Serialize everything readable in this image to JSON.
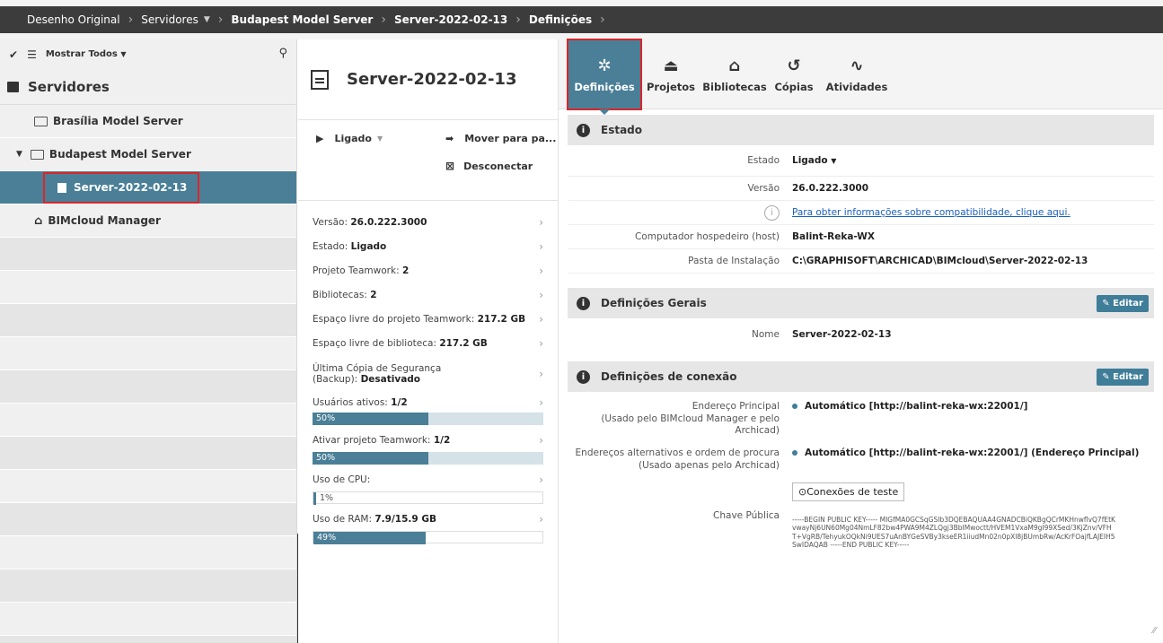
{
  "breadcrumb": {
    "items": [
      "Desenho Original",
      "Servidores",
      "Budapest Model Server",
      "Server-2022-02-13",
      "Definições"
    ]
  },
  "sidebar": {
    "filter_label": "Mostrar Todos",
    "title": "Servidores",
    "items": [
      {
        "label": "Brasília Model Server"
      },
      {
        "label": "Budapest Model Server"
      },
      {
        "label": "Server-2022-02-13"
      },
      {
        "label": "BIMcloud Manager"
      }
    ]
  },
  "server": {
    "name": "Server-2022-02-13",
    "status_action": "Ligado",
    "move_action": "Mover para pa...",
    "disconnect_action": "Desconectar",
    "info": [
      {
        "label": "Versão:",
        "value": "26.0.222.3000"
      },
      {
        "label": "Estado:",
        "value": "Ligado"
      },
      {
        "label": "Projeto Teamwork:",
        "value": "2"
      },
      {
        "label": "Bibliotecas:",
        "value": "2"
      },
      {
        "label": "Espaço livre do projeto Teamwork:",
        "value": "217.2 GB"
      },
      {
        "label": "Espaço livre de biblioteca:",
        "value": "217.2 GB"
      },
      {
        "label": "Última Cópia de Segurança (Backup):",
        "value": "Desativado"
      },
      {
        "label": "Usuários ativos:",
        "value": "1/2",
        "bar": "50%",
        "level": 0.5
      },
      {
        "label": "Ativar projeto Teamwork:",
        "value": "1/2",
        "bar": "50%",
        "level": 0.5
      },
      {
        "label": "Uso de CPU:",
        "value": "",
        "bar": "1%",
        "level": 0.01
      },
      {
        "label": "Uso de RAM:",
        "value": "7.9/15.9 GB",
        "bar": "49%",
        "level": 0.49
      }
    ]
  },
  "tabs": [
    "Definições",
    "Projetos",
    "Bibliotecas",
    "Cópias",
    "Atividades"
  ],
  "estado": {
    "title": "Estado",
    "estado_label": "Estado",
    "estado_value": "Ligado",
    "versao_label": "Versão",
    "versao_value": "26.0.222.3000",
    "compat_link": "Para obter informações sobre compatibilidade, clique aqui.",
    "host_label": "Computador hospedeiro (host)",
    "host_value": "Balint-Reka-WX",
    "path_label": "Pasta de Instalação",
    "path_value": "C:\\GRAPHISOFT\\ARCHICAD\\BIMcloud\\Server-2022-02-13"
  },
  "gerais": {
    "title": "Definições Gerais",
    "edit": "Editar",
    "nome_label": "Nome",
    "nome_value": "Server-2022-02-13"
  },
  "conexao": {
    "title": "Definições de conexão",
    "edit": "Editar",
    "principal_label": "Endereço Principal",
    "principal_sub": "(Usado pelo BIMcloud Manager e pelo Archicad)",
    "principal_value": "Automático [http://balint-reka-wx:22001/]",
    "alt_label": "Endereços alternativos e ordem de procura",
    "alt_sub": "(Usado apenas pelo Archicad)",
    "alt_value": "Automático [http://balint-reka-wx:22001/] (Endereço Principal)",
    "test_button": "Conexões de teste",
    "pk_label": "Chave Pública",
    "pk_value": "-----BEGIN PUBLIC KEY----- MIGfMA0GCSqGSIb3DQEBAQUAA4GNADCBiQKBgQCrMKHnwflvQ7fEtKvwayNj6UN60Mg04NmLF82bw4PWA9M4ZLQgj3BbIMwoctt/HVEM1VxaM9gI99XSed/3KjZnv/VFHT+VgRB/TehyukOQkNi9UES7uAnBYGeSVBy3kseER1iiudMn02n0pXl8jBUmbRw/AcKrFOajfLAJEIH5SwIDAQAB -----END PUBLIC KEY-----"
  }
}
